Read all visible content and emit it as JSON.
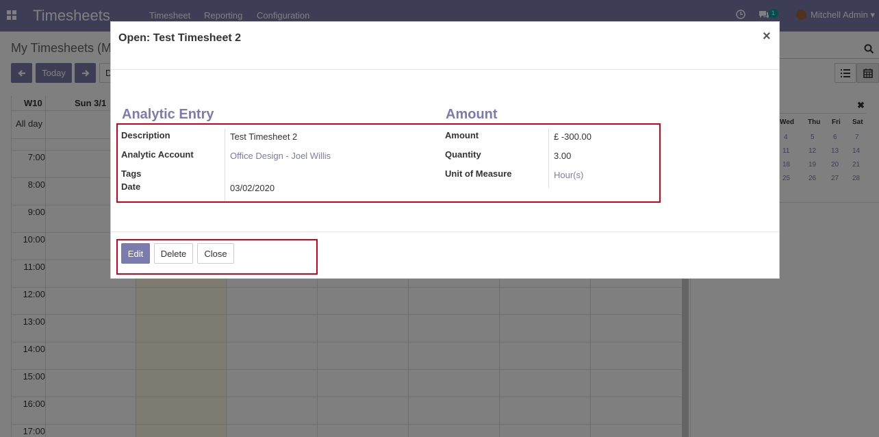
{
  "navbar": {
    "app_title": "Timesheets",
    "menu": [
      "Timesheet",
      "Reporting",
      "Configuration"
    ],
    "messages_count": "1",
    "user_name": "Mitchell Admin"
  },
  "control_panel": {
    "title": "My Timesheets (M",
    "today_label": "Today",
    "partial_button": "D"
  },
  "calendar": {
    "week_label": "W10",
    "first_day": "Sun 3/1",
    "allday_label": "All day",
    "hours": [
      "7:00",
      "8:00",
      "9:00",
      "10:00",
      "11:00",
      "12:00",
      "13:00",
      "14:00",
      "15:00",
      "16:00",
      "17:00"
    ]
  },
  "mini_calendar": {
    "headers": [
      "Wed",
      "Thu",
      "Fri",
      "Sat"
    ],
    "rows": [
      [
        "4",
        "5",
        "6",
        "7"
      ],
      [
        "11",
        "12",
        "13",
        "14"
      ],
      [
        "18",
        "19",
        "20",
        "21"
      ],
      [
        "25",
        "26",
        "27",
        "28"
      ]
    ]
  },
  "modal": {
    "title": "Open: Test Timesheet 2",
    "close_symbol": "×",
    "left_group": {
      "title": "Analytic Entry",
      "description_label": "Description",
      "description_value": "Test Timesheet 2",
      "account_label": "Analytic Account",
      "account_value": "Office Design - Joel Willis",
      "tags_label": "Tags",
      "date_label": "Date",
      "date_value": "03/02/2020"
    },
    "right_group": {
      "title": "Amount",
      "amount_label": "Amount",
      "amount_value": "£ -300.00",
      "quantity_label": "Quantity",
      "quantity_value": "3.00",
      "uom_label": "Unit of Measure",
      "uom_value": "Hour(s)"
    },
    "footer": {
      "edit": "Edit",
      "delete": "Delete",
      "close": "Close"
    }
  },
  "colors": {
    "brand": "#7c7bad",
    "highlight_border": "#d0021b"
  }
}
